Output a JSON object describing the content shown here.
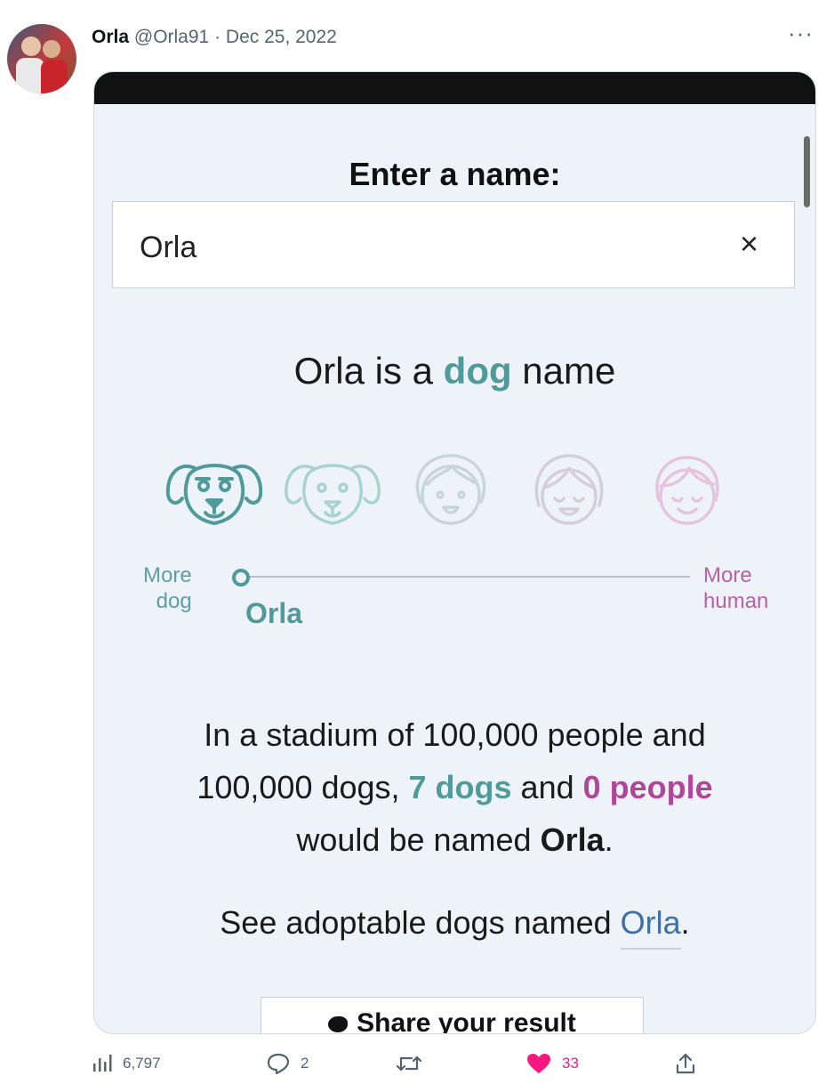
{
  "tweet": {
    "display_name": "Orla",
    "handle": "@Orla91",
    "separator": "·",
    "date": "Dec 25, 2022",
    "more_label": "···"
  },
  "card": {
    "enter_label": "Enter a name:",
    "input_value": "Orla",
    "clear_label": "×",
    "headline": {
      "prefix": "Orla is a ",
      "highlight": "dog",
      "suffix": " name"
    },
    "slider": {
      "left_label_1": "More",
      "left_label_2": "dog",
      "right_label_1": "More",
      "right_label_2": "human",
      "position_name": "Orla",
      "position_fraction": 0.02
    },
    "stats": {
      "line1": "In a stadium of 100,000 people and",
      "line2_prefix": "100,000 dogs, ",
      "dogs": "7 dogs",
      "and": " and ",
      "people": "0 people",
      "line3_prefix": "would be named ",
      "name": "Orla",
      "period": "."
    },
    "adopt": {
      "prefix": "See adoptable dogs named ",
      "link": "Orla",
      "suffix": "."
    },
    "share_label": "Share your result"
  },
  "actions": {
    "views": "6,797",
    "replies": "2",
    "retweets": "",
    "likes": "33"
  },
  "colors": {
    "teal": "#4f9a9b",
    "pink": "#b0459a",
    "like": "#f91880"
  },
  "icons": [
    "dog-icon",
    "dog-icon",
    "child-icon",
    "woman-icon",
    "woman-icon"
  ]
}
